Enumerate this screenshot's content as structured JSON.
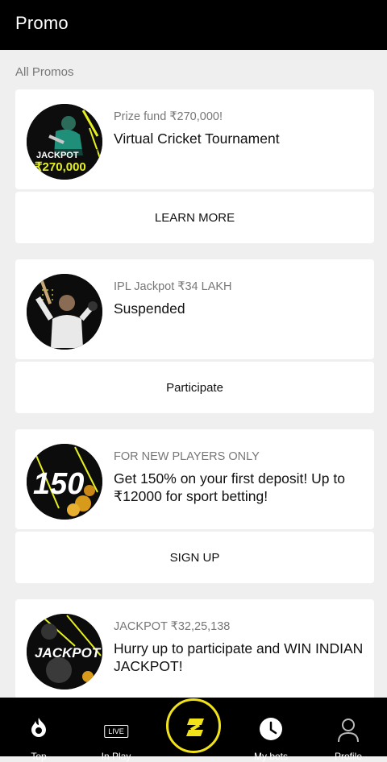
{
  "header": {
    "title": "Promo"
  },
  "section_label": "All Promos",
  "promos": [
    {
      "subtitle": "Prize fund ₹270,000!",
      "headline": "Virtual Cricket Tournament",
      "action_label": "LEARN MORE",
      "thumb_text_1": "JACKPOT",
      "thumb_text_2": "₹270,000"
    },
    {
      "subtitle": "IPL Jackpot ₹34 LAKH",
      "headline": "Suspended",
      "action_label": "Participate"
    },
    {
      "subtitle": "FOR NEW PLAYERS ONLY",
      "headline": "Get 150% on your first deposit! Up to ₹12000 for sport betting!",
      "action_label": "SIGN UP",
      "thumb_text_1": "150"
    },
    {
      "subtitle": "JACKPOT ₹32,25,138",
      "headline": "Hurry up to participate and WIN INDIAN JACKPOT!",
      "thumb_text_1": "JACKPOT"
    }
  ],
  "bottom_nav": {
    "items": [
      {
        "label": "Top",
        "icon": "flame-icon"
      },
      {
        "label": "In Play",
        "icon": "live-icon",
        "badge": "LIVE"
      },
      {
        "label": "",
        "icon": "logo-icon"
      },
      {
        "label": "My bets",
        "icon": "clock-icon"
      },
      {
        "label": "Profile",
        "icon": "person-icon"
      }
    ]
  },
  "colors": {
    "accent": "#f2e21a",
    "header_bg": "#000000",
    "page_bg": "#efefef"
  }
}
